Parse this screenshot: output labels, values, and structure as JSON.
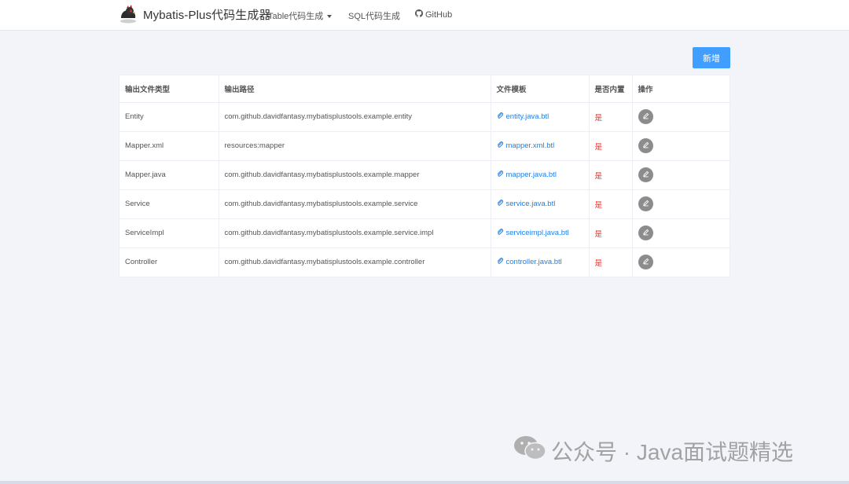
{
  "navbar": {
    "brand_title": "Mybatis-Plus代码生成器",
    "items": [
      {
        "label": "Table代码生成",
        "has_dropdown": true
      },
      {
        "label": "SQL代码生成",
        "has_dropdown": false
      },
      {
        "label": "GitHub",
        "icon": "github-icon"
      }
    ]
  },
  "toolbar": {
    "add_label": "新增"
  },
  "table": {
    "headers": [
      "输出文件类型",
      "输出路径",
      "文件模板",
      "是否内置",
      "操作"
    ],
    "rows": [
      {
        "type": "Entity",
        "path": "com.github.davidfantasy.mybatisplustools.example.entity",
        "template": "entity.java.btl",
        "builtin": "是"
      },
      {
        "type": "Mapper.xml",
        "path": "resources:mapper",
        "template": "mapper.xml.btl",
        "builtin": "是"
      },
      {
        "type": "Mapper.java",
        "path": "com.github.davidfantasy.mybatisplustools.example.mapper",
        "template": "mapper.java.btl",
        "builtin": "是"
      },
      {
        "type": "Service",
        "path": "com.github.davidfantasy.mybatisplustools.example.service",
        "template": "service.java.btl",
        "builtin": "是"
      },
      {
        "type": "ServiceImpl",
        "path": "com.github.davidfantasy.mybatisplustools.example.service.impl",
        "template": "serviceimpl.java.btl",
        "builtin": "是"
      },
      {
        "type": "Controller",
        "path": "com.github.davidfantasy.mybatisplustools.example.controller",
        "template": "controller.java.btl",
        "builtin": "是"
      }
    ]
  },
  "watermark": {
    "text": "公众号 · Java面试题精选"
  },
  "colors": {
    "primary": "#409eff",
    "link": "#1e80e8",
    "danger": "#f0332b",
    "edit_button": "#8c8c8c"
  }
}
